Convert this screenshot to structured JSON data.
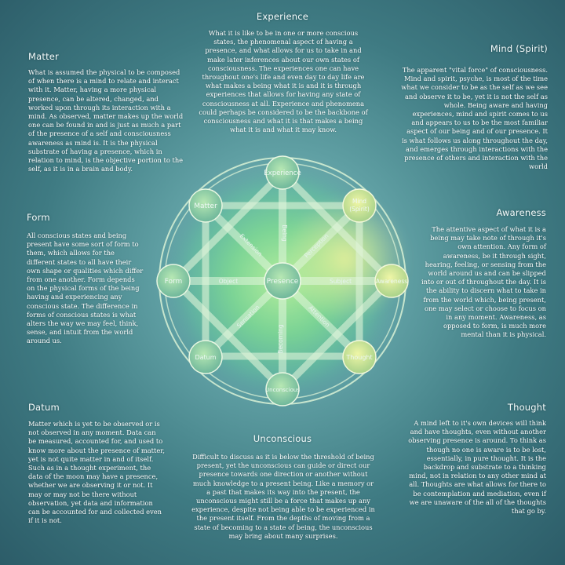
{
  "sections": {
    "experience": {
      "title": "Experience",
      "text": "What it is like to be in one or more conscious states, the phenomenal aspect of having a presence, and what allows for us to take in and make later inferences about our own states of consciousness. The experiences one can have throughout one's life and even day to day life are what makes a being what it is and it is through experiences that allows for having any state of consciousness at all. Experience and phenomena could perhaps be considered to be the backbone of consciousness and what it is that makes a being what it is and what it may know."
    },
    "matter": {
      "title": "Matter",
      "text": "What is assumed the physical to be composed of when there is a mind to relate and interact with it. Matter, having a more physical presence, can be altered, changed, and worked upon through its interaction with a mind. As observed, matter makes up the world one can be found in and is just as much a part of the presence of a self and consciousness awareness as mind is. It is the physical substrate of having a presence, which in relation to mind, is the objective portion to the self, as it is in a brain and body."
    },
    "mind": {
      "title": "Mind (Spirit)",
      "text": "The apparent \"vital force\" of consciousness. Mind and spirit, psyche, is most of the time what we consider to be as the self as we see and observe it to be, yet it is not the self as whole. Being aware and having experiences, mind and spirit comes to us and appears to us to be the most familiar aspect of our being and of our presence. It is what follows us along throughout the day, and emerges through interactions with the presence of others and interaction with the world"
    },
    "form": {
      "title": "Form",
      "text": "All conscious states and being present have some sort of form to them, which allows for the different states to all have their own shape or qualities which differ from one another. Form depends on the physical forms of the being having and experiencing any conscious state. The difference in forms of conscious states is what alters the way we may feel, think, sense, and intuit from the world around us."
    },
    "awareness": {
      "title": "Awareness",
      "text": "The attentive aspect of what it is a being may take note of through it's own attention. Any form of awareness, be it through sight, hearing, feeling, or sensing from the world around us and can be slipped into or out of throughout the day. It is the ability to discern what to take in from the world which, being present, one may select or choose to focus on in any moment. Awareness, as opposed to form, is much more mental than it is physical."
    },
    "datum": {
      "title": "Datum",
      "text": "Matter which is yet to be observed or is not observed in any moment. Data can be measured, accounted for, and used to know more about the presence of matter, yet is not quite matter in and of itself. Such as in a thought experiment, the data of the moon may have a presence, whether we are observing it or not. It may or may not be there without observation, yet data and information can be accounted for and collected even if it is not."
    },
    "thought": {
      "title": "Thought",
      "text": "A mind left to it's own devices will think and have thoughts, even without another observing presence is around. To think as though no one is aware is to be lost, essentially, in pure thought. It is the backdrop and substrate to a thinking mind, not in relation to any other mind at all. Thoughts are what allows for there to be contemplation and mediation, even if we are unaware of the all of the thoughts that go by."
    },
    "unconscious": {
      "title": "Unconscious",
      "text": "Difficult to discuss as it is below the threshold of being present, yet the unconscious can guide or direct our presence towards one direction or another without much knowledge to a present being. Like a memory or a past that makes its way into the present, the unconscious might still be a force that makes up any experience, despite not being able to be experienced in the present itself. From the depths of moving from a state of becoming to a state of being, the unconscious may bring about many surprises."
    }
  },
  "diagram": {
    "center": "Presence",
    "nodes": {
      "experience": "Experience",
      "matter": "Matter",
      "mind_line1": "Mind",
      "mind_line2": "(Spirit)",
      "form": "Form",
      "awareness": "Awareness",
      "datum": "Datum",
      "thought": "Thought",
      "unconscious": "Unconscious"
    },
    "spokes": {
      "being": "Being",
      "becoming": "Becoming",
      "object": "Object",
      "subject": "Subject",
      "extension": "Extension",
      "perception": "Perception",
      "sensation": "Sensation",
      "attention": "Attention"
    }
  },
  "colors": {
    "background": "#3f7b83",
    "ring": "#d9f2d6",
    "glow_green": "#7fdc8a",
    "glow_yellow": "#e7f08a"
  }
}
